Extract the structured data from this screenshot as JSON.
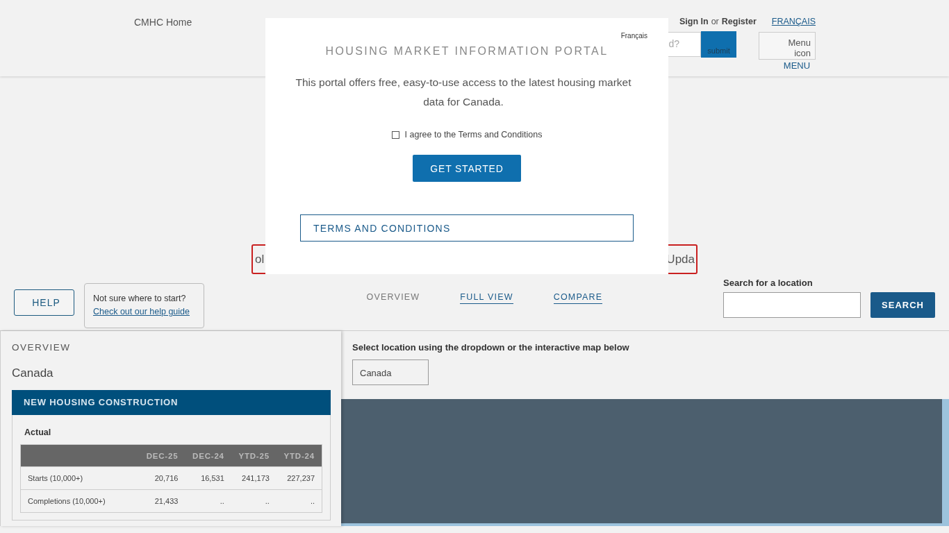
{
  "header": {
    "logo_alt": "CMHC Home",
    "sign_in": "Sign In",
    "or": "or",
    "register": "Register",
    "language": "FRANÇAIS",
    "search_placeholder": "d?",
    "submit_alt": "submit",
    "menu_icon_alt": "Menu icon",
    "menu_label": "MENU"
  },
  "banner": {
    "left_text": "ol",
    "right_text": "Upda"
  },
  "help": {
    "button": "HELP",
    "tip_text": "Not sure where to start?",
    "tip_link": "Check out our help guide"
  },
  "view_tabs": [
    {
      "label": "OVERVIEW",
      "selected": true
    },
    {
      "label": "FULL VIEW",
      "selected": false
    },
    {
      "label": "COMPARE",
      "selected": false
    }
  ],
  "location_search": {
    "label": "Search for a location",
    "button": "SEARCH"
  },
  "overview": {
    "heading": "OVERVIEW",
    "location": "Canada",
    "section_title": "NEW HOUSING CONSTRUCTION",
    "subtitle": "Actual",
    "table": {
      "columns": [
        "DEC-25",
        "DEC-24",
        "YTD-25",
        "YTD-24"
      ],
      "rows": [
        {
          "label": "Starts (10,000+)",
          "cells": [
            "20,716",
            "16,531",
            "241,173",
            "227,237"
          ]
        },
        {
          "label": "Completions (10,000+)",
          "cells": [
            "21,433",
            "..",
            "..",
            ".."
          ]
        }
      ]
    }
  },
  "location_select": {
    "label": "Select location using the dropdown or the interactive map below",
    "value": "Canada"
  },
  "modal": {
    "language": "Français",
    "title": "HOUSING MARKET INFORMATION PORTAL",
    "description": "This portal offers free, easy-to-use access to the latest housing market data for Canada.",
    "agree_label": "I agree to the Terms and Conditions",
    "agree_checked": false,
    "start_button": "GET STARTED",
    "terms_button": "TERMS AND CONDITIONS"
  }
}
